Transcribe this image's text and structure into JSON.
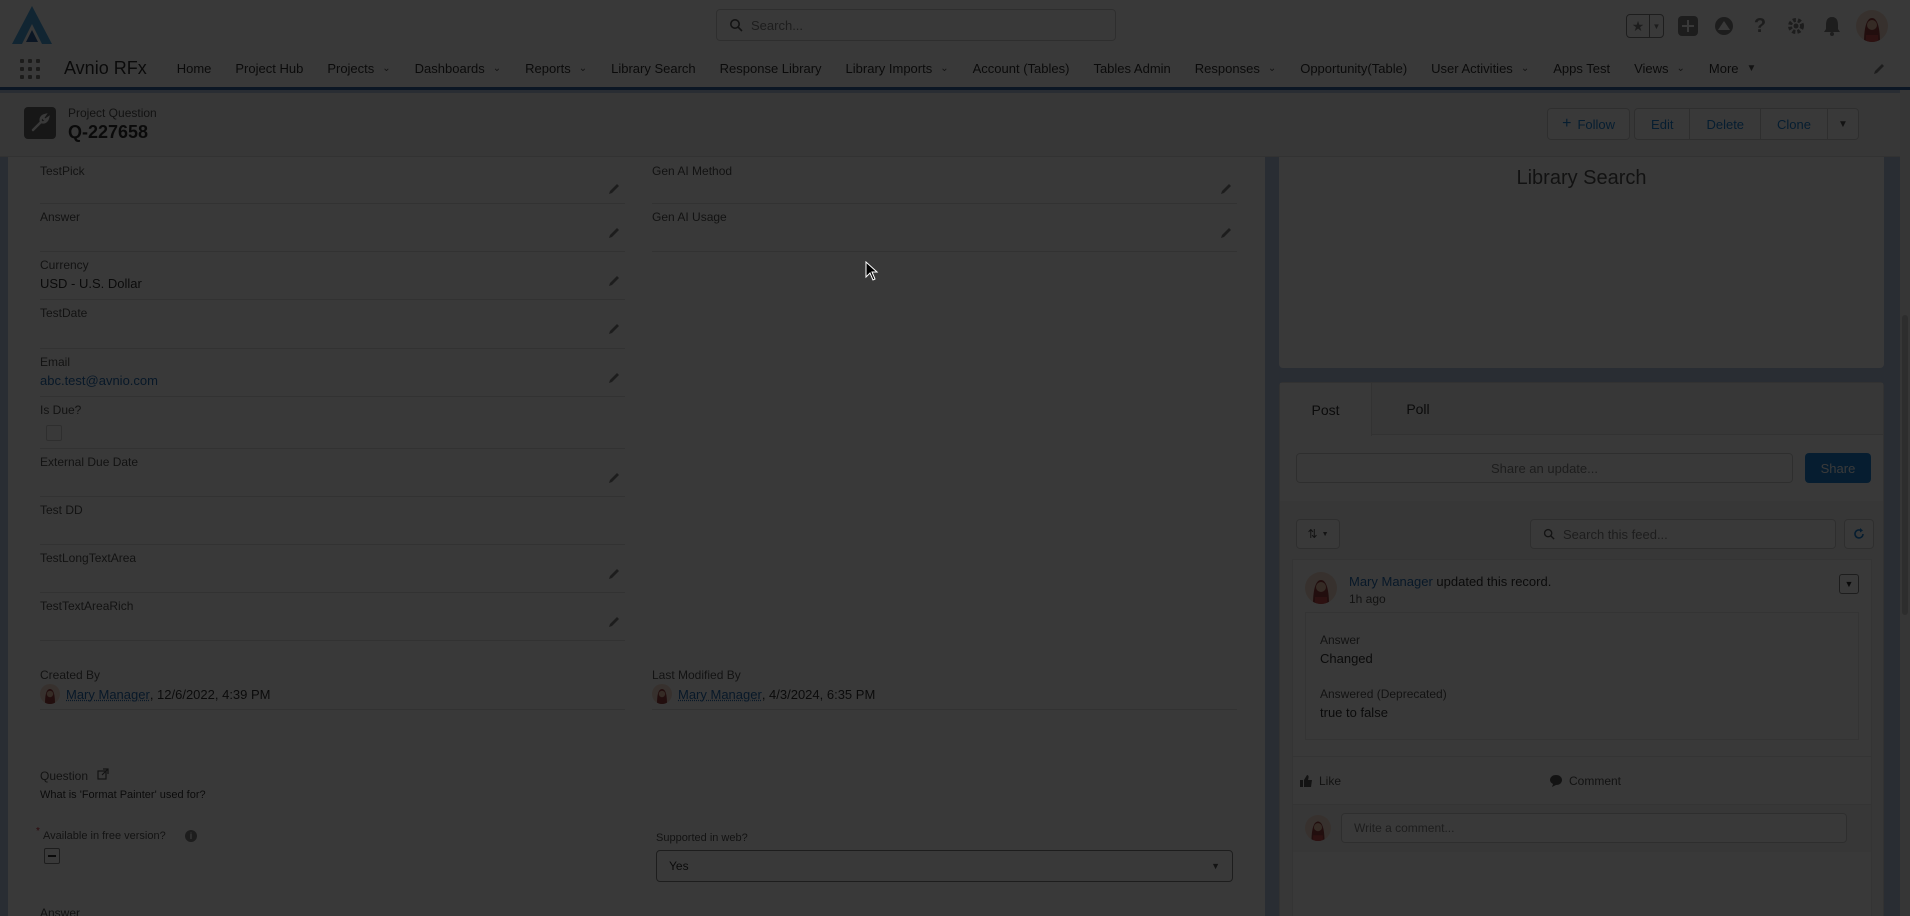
{
  "header": {
    "search_placeholder": "Search...",
    "icons": [
      "favorites-star-icon",
      "favorites-dropdown-icon",
      "global-create-icon",
      "trailhead-icon",
      "help-icon",
      "setup-gear-icon",
      "notifications-bell-icon",
      "user-avatar"
    ]
  },
  "nav": {
    "app_name": "Avnio RFx",
    "items": [
      {
        "label": "Home",
        "menu": false
      },
      {
        "label": "Project Hub",
        "menu": false
      },
      {
        "label": "Projects",
        "menu": true
      },
      {
        "label": "Dashboards",
        "menu": true
      },
      {
        "label": "Reports",
        "menu": true
      },
      {
        "label": "Library Search",
        "menu": false
      },
      {
        "label": "Response Library",
        "menu": false
      },
      {
        "label": "Library Imports",
        "menu": true
      },
      {
        "label": "Account (Tables)",
        "menu": false
      },
      {
        "label": "Tables Admin",
        "menu": false
      },
      {
        "label": "Responses",
        "menu": true
      },
      {
        "label": "Opportunity(Table)",
        "menu": false
      },
      {
        "label": "User Activities",
        "menu": true
      },
      {
        "label": "Apps Test",
        "menu": false
      },
      {
        "label": "Views",
        "menu": true
      },
      {
        "label": "More",
        "menu": true
      }
    ]
  },
  "record": {
    "type": "Project Question",
    "title": "Q-227658",
    "actions": {
      "follow": "Follow",
      "edit": "Edit",
      "delete": "Delete",
      "clone": "Clone"
    }
  },
  "details": {
    "test_pick": {
      "label": "TestPick",
      "value": ""
    },
    "answer": {
      "label": "Answer",
      "value": ""
    },
    "currency": {
      "label": "Currency",
      "value": "USD - U.S. Dollar"
    },
    "test_date": {
      "label": "TestDate",
      "value": ""
    },
    "email": {
      "label": "Email",
      "value": "abc.test@avnio.com"
    },
    "is_due": {
      "label": "Is Due?",
      "checked": false
    },
    "external_due_date": {
      "label": "External Due Date",
      "value": ""
    },
    "test_dd": {
      "label": "Test DD",
      "value": ""
    },
    "test_long_text_area": {
      "label": "TestLongTextArea",
      "value": ""
    },
    "test_text_area_rich": {
      "label": "TestTextAreaRich",
      "value": ""
    },
    "gen_ai_method": {
      "label": "Gen AI Method",
      "value": ""
    },
    "gen_ai_usage": {
      "label": "Gen AI Usage",
      "value": ""
    },
    "created_by": {
      "label": "Created By",
      "user": "Mary Manager",
      "date": ", 12/6/2022, 4:39 PM"
    },
    "last_modified_by": {
      "label": "Last Modified By",
      "user": "Mary Manager",
      "date": ", 4/3/2024, 6:35 PM"
    },
    "question": {
      "label": "Question",
      "value": "What is 'Format Painter' used for?"
    },
    "available_free": {
      "required_mark": "*",
      "label": "Available in free version?"
    },
    "supported_web": {
      "label": "Supported in web?",
      "value": "Yes"
    },
    "answer_bottom": {
      "label": "Answer"
    }
  },
  "library_card": {
    "title": "Library Search"
  },
  "feed": {
    "tabs": [
      "Post",
      "Poll"
    ],
    "share_placeholder": "Share an update...",
    "share_button": "Share",
    "search_placeholder": "Search this feed...",
    "post": {
      "user": "Mary Manager",
      "action": " updated this record.",
      "time": "1h ago",
      "changes": [
        {
          "field": "Answer",
          "value": "Changed"
        },
        {
          "field": "Answered (Deprecated)",
          "value": "true to false"
        }
      ],
      "like_label": "Like",
      "comment_label": "Comment",
      "comment_placeholder": "Write a comment..."
    }
  },
  "colors": {
    "brand": "#0176d3",
    "nav_underline": "#1b5297",
    "background": "#b0c4df",
    "link": "#0b5cab",
    "overlay": "rgba(8,7,7,0.80)"
  }
}
